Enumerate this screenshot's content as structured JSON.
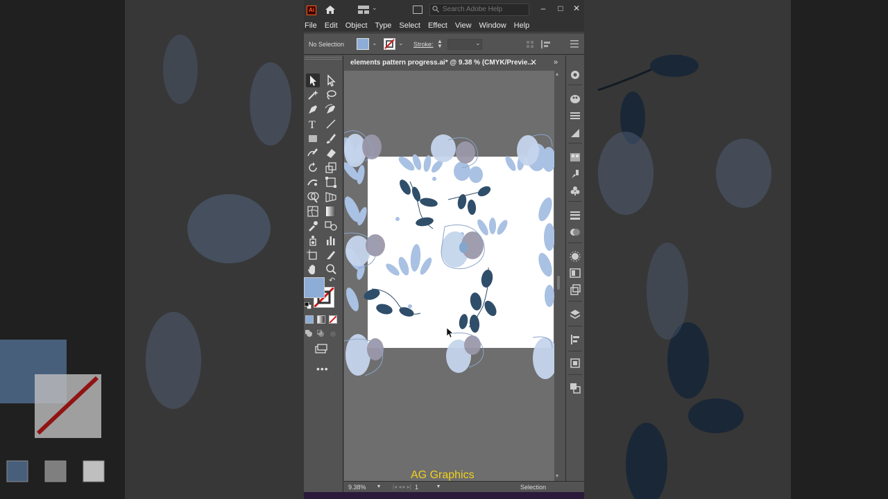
{
  "app": {
    "logo_text": "Ai",
    "search_placeholder": "Search Adobe Help",
    "window_controls": [
      "–",
      "□",
      "✕"
    ]
  },
  "menu": [
    "File",
    "Edit",
    "Object",
    "Type",
    "Select",
    "Effect",
    "View",
    "Window",
    "Help"
  ],
  "control_bar": {
    "selection_status": "No Selection",
    "stroke_label": "Stroke:",
    "fill_color": "#8dadd7"
  },
  "document": {
    "tab_title": "elements pattern progress.ai* @ 9.38 % (CMYK/Previe...",
    "close_symbol": "✕"
  },
  "status_bar": {
    "zoom": "9.38%",
    "artboard_number": "1",
    "nav_arrows": "|◂ ◂   ▸ ▸|",
    "current_tool": "Selection"
  },
  "watermark": "AG Graphics",
  "colors": {
    "leaf_dark": "#2f4e6a",
    "splash_light": "#a9c1e3",
    "flower_mauve": "#8a8698",
    "fill_swatch": "#8dadd7"
  },
  "icons": {
    "toolbox": [
      "selection-tool",
      "direct-selection-tool",
      "magic-wand-tool",
      "lasso-tool",
      "pen-tool",
      "curvature-tool",
      "type-tool",
      "line-tool",
      "rectangle-tool",
      "paintbrush-tool",
      "shaper-tool",
      "eraser-tool",
      "rotate-tool",
      "scale-tool",
      "puppet-warp-tool",
      "free-transform-tool",
      "shape-builder-tool",
      "perspective-grid-tool",
      "mesh-tool",
      "gradient-tool",
      "eyedropper-tool",
      "blend-tool",
      "symbol-sprayer-tool",
      "column-graph-tool",
      "artboard-tool",
      "slice-tool",
      "hand-tool",
      "zoom-tool"
    ]
  }
}
